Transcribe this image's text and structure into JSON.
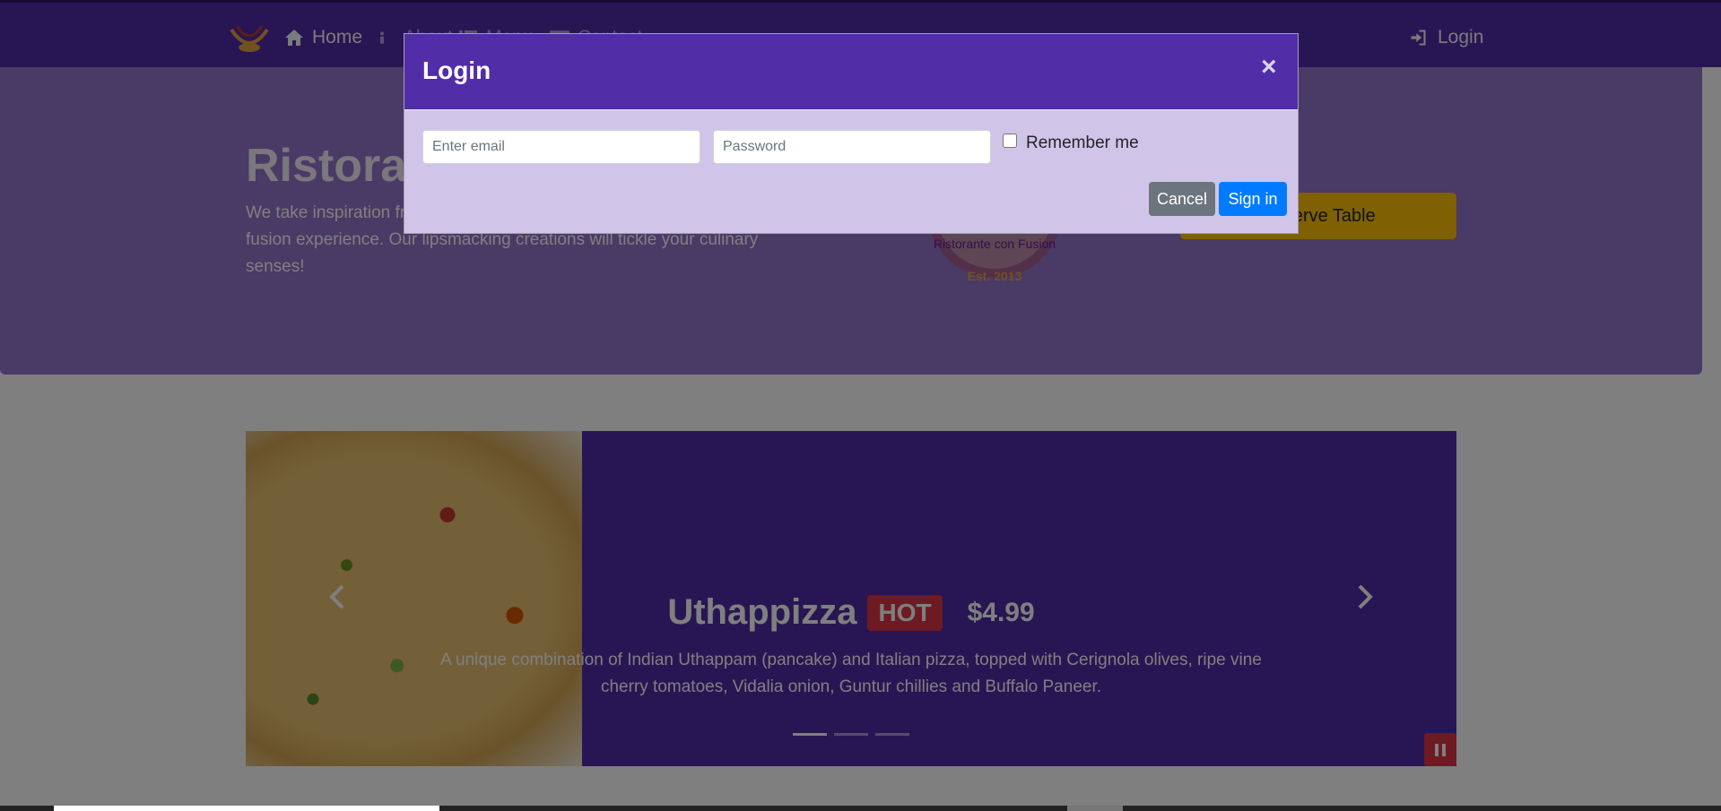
{
  "nav": {
    "home": "Home",
    "about": "About",
    "menu": "Menu",
    "contact": "Contact",
    "login": "Login"
  },
  "jumbotron": {
    "title": "Ristorante con Fusion",
    "text": "We take inspiration from the World's best cuisines, and create a unique fusion experience. Our lipsmacking creations will tickle your culinary senses!",
    "logo_text": "Ristorante con Fusion",
    "logo_est": "Est. 2013",
    "reserve_label": "Reserve Table"
  },
  "carousel": {
    "title": "Uthappizza",
    "badge": "HOT",
    "price": "$4.99",
    "description": "A unique combination of Indian Uthappam (pancake) and Italian pizza, topped with Cerignola olives, ripe vine cherry tomatoes, Vidalia onion, Guntur chillies and Buffalo Paneer.",
    "indicators": 3,
    "active_index": 0
  },
  "modal": {
    "title": "Login",
    "close": "×",
    "email_placeholder": "Enter email",
    "password_placeholder": "Password",
    "remember_label": "Remember me",
    "cancel_label": "Cancel",
    "signin_label": "Sign in"
  },
  "colors": {
    "primary": "#512da8",
    "jumbotron": "#9575cd",
    "modal_body": "#d1c4e9",
    "warning": "#ffc107",
    "danger": "#dc3545",
    "btn_secondary": "#6c757d",
    "btn_primary": "#007bff"
  },
  "icons": {
    "home": "home-icon",
    "about": "info-icon",
    "menu": "list-icon",
    "contact": "address-card-icon",
    "login": "sign-in-icon",
    "prev": "chevron-left-icon",
    "next": "chevron-right-icon",
    "pause": "pause-icon"
  }
}
